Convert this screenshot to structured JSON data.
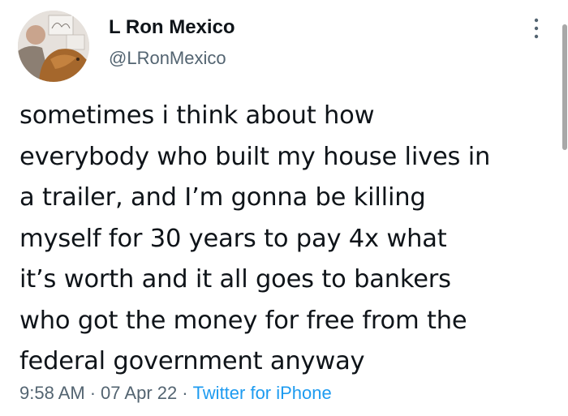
{
  "author": {
    "display_name": "L Ron Mexico",
    "handle": "@LRonMexico",
    "avatar_icon": "profile-photo"
  },
  "more_menu_icon": "more-vertical-icon",
  "tweet": {
    "text": "sometimes i think about how\neverybody who built my house lives in\na trailer, and I’m gonna be killing\nmyself for 30 years to pay 4x what\nit’s worth and it all goes to bankers\nwho got the money for free from the\nfederal government anyway"
  },
  "meta": {
    "time": "9:58 AM",
    "separator": "·",
    "date": "07 Apr 22",
    "source": "Twitter for iPhone"
  },
  "colors": {
    "text": "#0f1419",
    "secondary": "#536471",
    "link": "#1d9bf0"
  }
}
